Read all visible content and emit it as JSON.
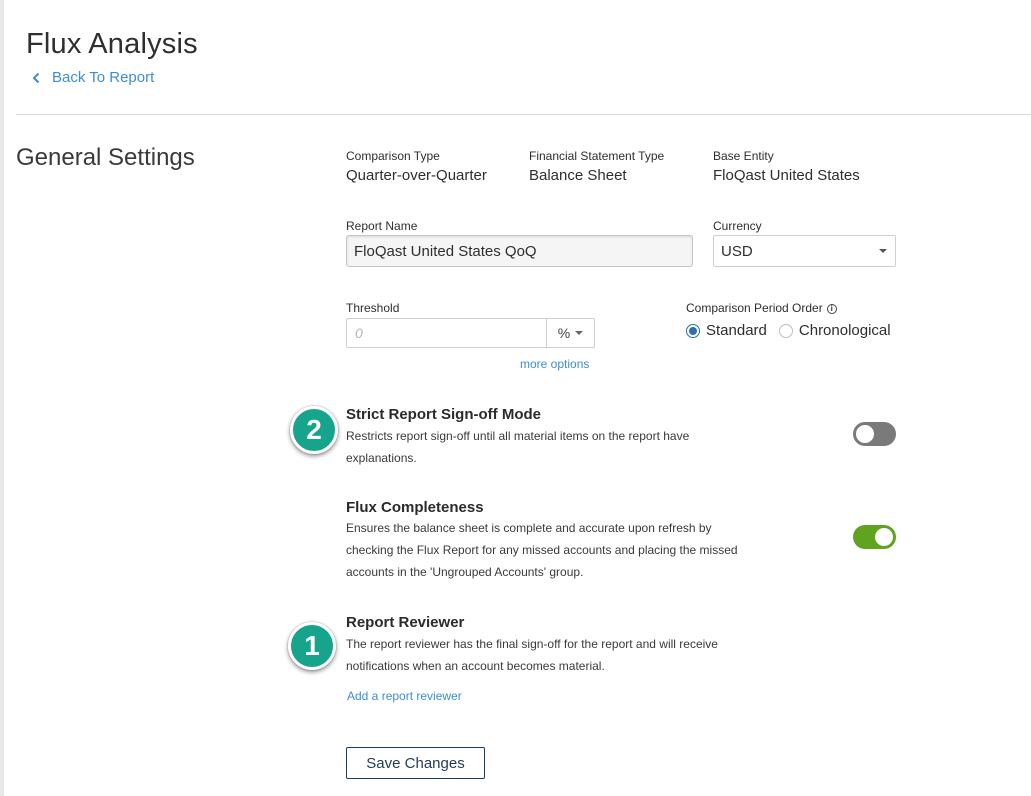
{
  "header": {
    "title": "Flux Analysis",
    "back_label": "Back To Report"
  },
  "general": {
    "title": "General Settings",
    "comparison_type": {
      "label": "Comparison Type",
      "value": "Quarter-over-Quarter"
    },
    "statement_type": {
      "label": "Financial Statement Type",
      "value": "Balance Sheet"
    },
    "base_entity": {
      "label": "Base Entity",
      "value": "FloQast United States"
    },
    "report_name": {
      "label": "Report Name",
      "value": "FloQast United States QoQ"
    },
    "currency": {
      "label": "Currency",
      "value": "USD"
    },
    "threshold": {
      "label": "Threshold",
      "placeholder": "0",
      "unit": "%",
      "more_options": "more options"
    },
    "period_order": {
      "label": "Comparison Period Order",
      "options": [
        "Standard",
        "Chronological"
      ],
      "selected": "Standard"
    }
  },
  "strict_signoff": {
    "title": "Strict Report Sign-off Mode",
    "desc_line1": "Restricts report sign-off until all material items on the report have",
    "desc_line2": "explanations.",
    "enabled": false
  },
  "flux_completeness": {
    "title": "Flux Completeness",
    "desc_line1": "Ensures the balance sheet is complete and accurate upon refresh by",
    "desc_line2": "checking the Flux Report for any missed accounts and placing the missed",
    "desc_line3": "accounts in the 'Ungrouped Accounts' group.",
    "enabled": true
  },
  "reviewer": {
    "title": "Report Reviewer",
    "desc_line1": "The report reviewer has the final sign-off for the report and will receive",
    "desc_line2": "notifications when an account becomes material.",
    "add_label": "Add a report reviewer"
  },
  "badges": {
    "first": "2",
    "second": "1",
    "color": "#16a48c"
  },
  "actions": {
    "save_label": "Save Changes"
  },
  "colors": {
    "link": "#3d8ed4",
    "toggle_on": "#5fa31e",
    "toggle_off": "#7a7a7a"
  }
}
